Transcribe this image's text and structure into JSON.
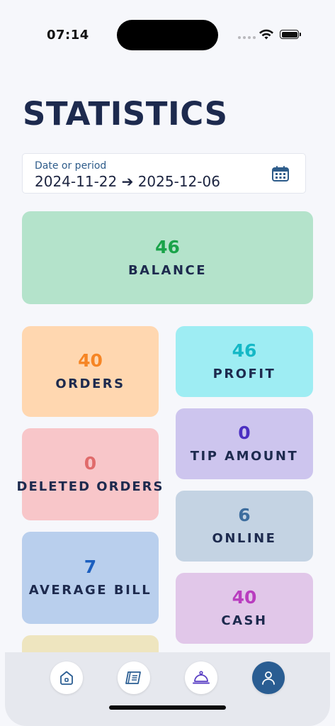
{
  "status": {
    "time": "07:14"
  },
  "page": {
    "title": "STATISTICS"
  },
  "date_filter": {
    "label": "Date or period",
    "value": "2024-11-22 ➔ 2025-12-06",
    "icon": "calendar-icon"
  },
  "cards": {
    "balance": {
      "value": "46",
      "label": "BALANCE",
      "color": "#1aa34a"
    },
    "orders": {
      "value": "40",
      "label": "ORDERS",
      "color": "#f68524"
    },
    "deleted_orders": {
      "value": "0",
      "label": "DELETED ORDERS",
      "color": "#e06b6b"
    },
    "average_bill": {
      "value": "7",
      "label": "AVERAGE BILL",
      "color": "#1c5fbf"
    },
    "profit": {
      "value": "46",
      "label": "PROFIT",
      "color": "#14b8c6"
    },
    "tip_amount": {
      "value": "0",
      "label": "TIP AMOUNT",
      "color": "#4b2fc2"
    },
    "online": {
      "value": "6",
      "label": "ONLINE",
      "color": "#3d6d9e"
    },
    "cash": {
      "value": "40",
      "label": "CASH",
      "color": "#b93dbf"
    }
  },
  "nav": {
    "items": [
      {
        "icon": "home-icon"
      },
      {
        "icon": "menu-book-icon"
      },
      {
        "icon": "cloche-icon"
      },
      {
        "icon": "user-icon",
        "active": true
      }
    ],
    "accent": "#2a5d92"
  }
}
